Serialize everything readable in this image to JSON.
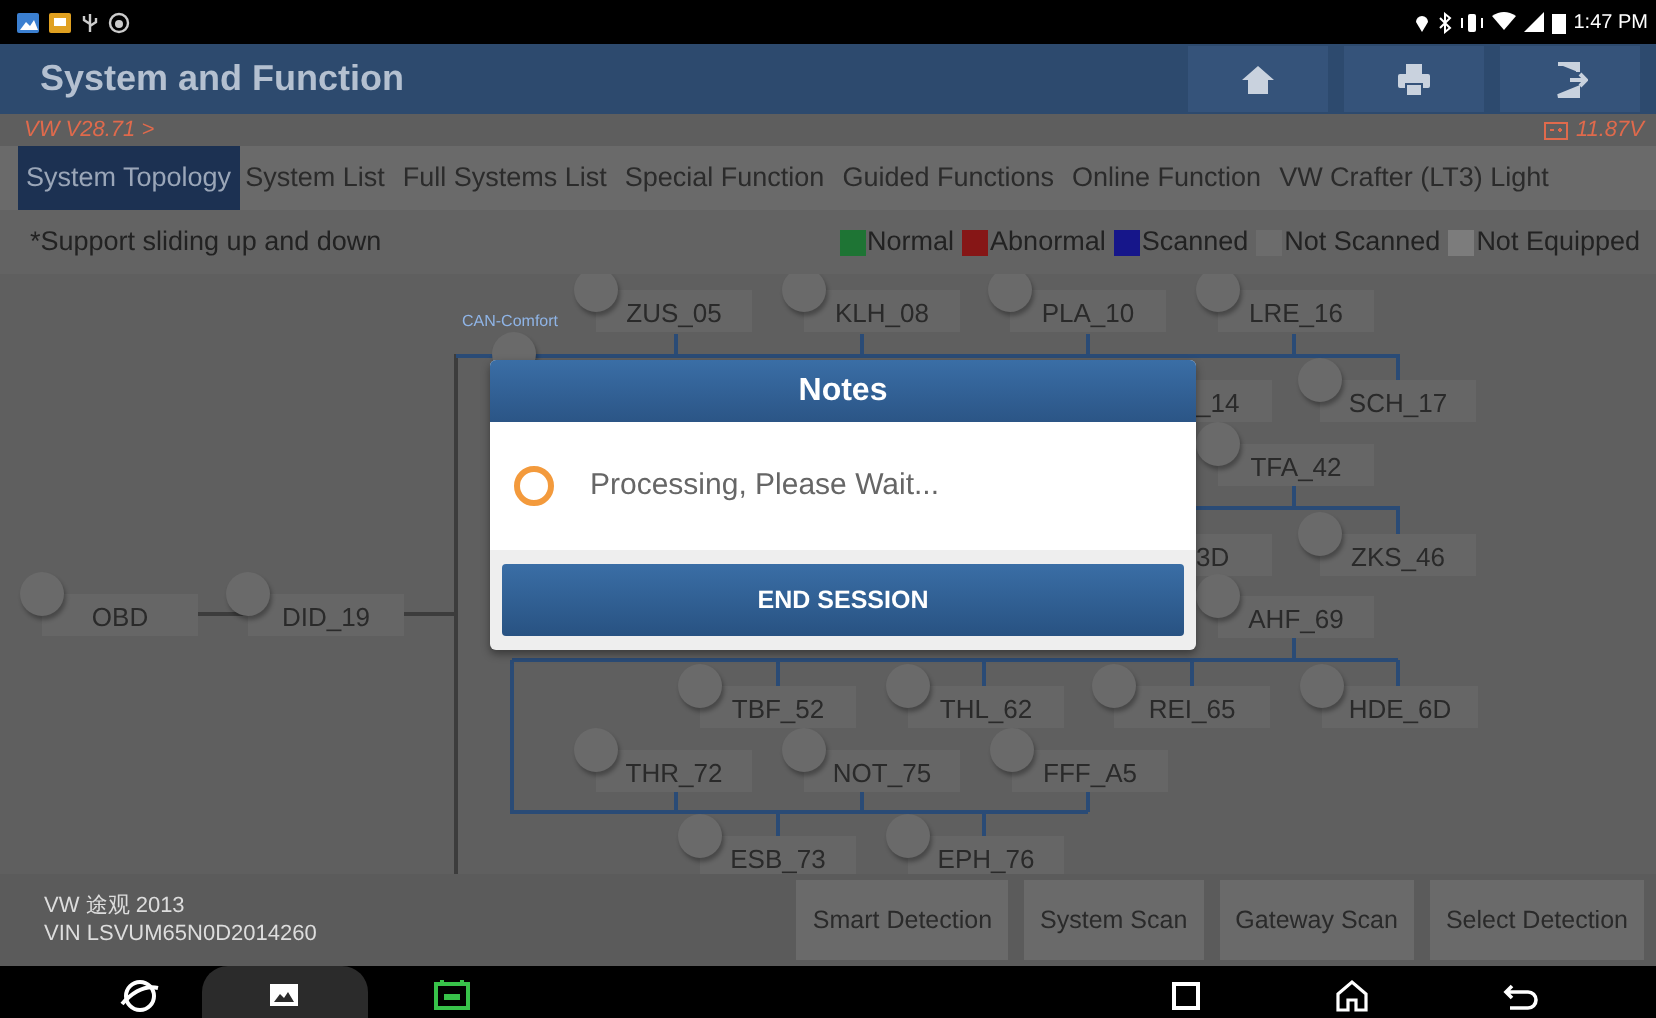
{
  "status_bar": {
    "time": "1:47 PM"
  },
  "header": {
    "title": "System and Function"
  },
  "info_bar": {
    "version": "VW V28.71 >",
    "voltage": "11.87V"
  },
  "tabs": [
    {
      "label": "System Topology",
      "selected": true
    },
    {
      "label": "System List",
      "selected": false
    },
    {
      "label": "Full Systems List",
      "selected": false
    },
    {
      "label": "Special Function",
      "selected": false
    },
    {
      "label": "Guided Functions",
      "selected": false
    },
    {
      "label": "Online Function",
      "selected": false
    },
    {
      "label": "VW Crafter (LT3) Light",
      "selected": false
    }
  ],
  "hint": "*Support sliding up and down",
  "legend": [
    {
      "label": "Normal",
      "color": "#1e7434"
    },
    {
      "label": "Abnormal",
      "color": "#861616"
    },
    {
      "label": "Scanned",
      "color": "#16168a"
    },
    {
      "label": "Not Scanned",
      "color": "#6c6c6c"
    },
    {
      "label": "Not Equipped",
      "color": "#7c7c7c"
    }
  ],
  "topology": {
    "bus_label": "CAN-Comfort",
    "nodes": [
      {
        "label": "OBD"
      },
      {
        "label": "DID_19"
      },
      {
        "label": "ZUS_05"
      },
      {
        "label": "KLH_08"
      },
      {
        "label": "PLA_10"
      },
      {
        "label": "LRE_16"
      },
      {
        "label": "_14"
      },
      {
        "label": "SCH_17"
      },
      {
        "label": "TFA_42"
      },
      {
        "label": "3D"
      },
      {
        "label": "ZKS_46"
      },
      {
        "label": "AHF_69"
      },
      {
        "label": "TBF_52"
      },
      {
        "label": "THL_62"
      },
      {
        "label": "REI_65"
      },
      {
        "label": "HDE_6D"
      },
      {
        "label": "THR_72"
      },
      {
        "label": "NOT_75"
      },
      {
        "label": "FFF_A5"
      },
      {
        "label": "ESB_73"
      },
      {
        "label": "EPH_76"
      }
    ]
  },
  "dialog": {
    "title": "Notes",
    "message": "Processing, Please Wait...",
    "button": "END SESSION"
  },
  "vehicle": {
    "model": "VW 途观 2013",
    "vin": "VIN LSVUM65N0D2014260"
  },
  "actions": [
    "Smart Detection",
    "System Scan",
    "Gateway Scan",
    "Select Detection"
  ]
}
